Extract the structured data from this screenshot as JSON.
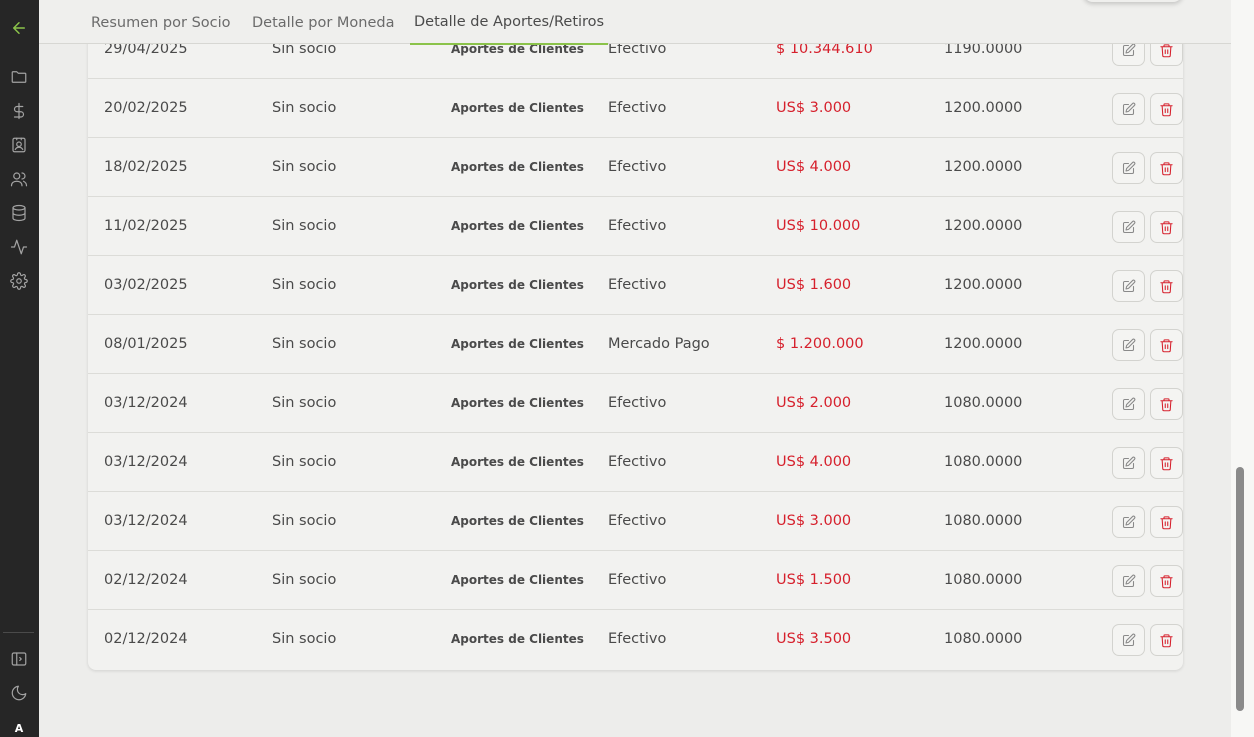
{
  "sidebar": {
    "icons": [
      "back-arrow-icon",
      "folder-icon",
      "dollar-icon",
      "contact-book-icon",
      "users-icon",
      "database-icon",
      "activity-icon",
      "gear-icon",
      "sidebar-toggle-icon",
      "moon-icon"
    ],
    "avatar_letter": "A"
  },
  "tabs": [
    {
      "label": "Resumen por Socio",
      "active": false
    },
    {
      "label": "Detalle por Moneda",
      "active": false
    },
    {
      "label": "Detalle de Aportes/Retiros",
      "active": true
    }
  ],
  "colors": {
    "accent": "#8bc34a",
    "amount": "#d6202c",
    "sidebar": "#262626"
  },
  "rows": [
    {
      "fecha": "29/04/2025",
      "socio": "Sin socio",
      "tipo": "Aportes de Clientes",
      "medio": "Efectivo",
      "monto": "$ 10.344.610",
      "cotizacion": "1190.0000"
    },
    {
      "fecha": "20/02/2025",
      "socio": "Sin socio",
      "tipo": "Aportes de Clientes",
      "medio": "Efectivo",
      "monto": "US$ 3.000",
      "cotizacion": "1200.0000"
    },
    {
      "fecha": "18/02/2025",
      "socio": "Sin socio",
      "tipo": "Aportes de Clientes",
      "medio": "Efectivo",
      "monto": "US$ 4.000",
      "cotizacion": "1200.0000"
    },
    {
      "fecha": "11/02/2025",
      "socio": "Sin socio",
      "tipo": "Aportes de Clientes",
      "medio": "Efectivo",
      "monto": "US$ 10.000",
      "cotizacion": "1200.0000"
    },
    {
      "fecha": "03/02/2025",
      "socio": "Sin socio",
      "tipo": "Aportes de Clientes",
      "medio": "Efectivo",
      "monto": "US$ 1.600",
      "cotizacion": "1200.0000"
    },
    {
      "fecha": "08/01/2025",
      "socio": "Sin socio",
      "tipo": "Aportes de Clientes",
      "medio": "Mercado Pago",
      "monto": "$ 1.200.000",
      "cotizacion": "1200.0000"
    },
    {
      "fecha": "03/12/2024",
      "socio": "Sin socio",
      "tipo": "Aportes de Clientes",
      "medio": "Efectivo",
      "monto": "US$ 2.000",
      "cotizacion": "1080.0000"
    },
    {
      "fecha": "03/12/2024",
      "socio": "Sin socio",
      "tipo": "Aportes de Clientes",
      "medio": "Efectivo",
      "monto": "US$ 4.000",
      "cotizacion": "1080.0000"
    },
    {
      "fecha": "03/12/2024",
      "socio": "Sin socio",
      "tipo": "Aportes de Clientes",
      "medio": "Efectivo",
      "monto": "US$ 3.000",
      "cotizacion": "1080.0000"
    },
    {
      "fecha": "02/12/2024",
      "socio": "Sin socio",
      "tipo": "Aportes de Clientes",
      "medio": "Efectivo",
      "monto": "US$ 1.500",
      "cotizacion": "1080.0000"
    },
    {
      "fecha": "02/12/2024",
      "socio": "Sin socio",
      "tipo": "Aportes de Clientes",
      "medio": "Efectivo",
      "monto": "US$ 3.500",
      "cotizacion": "1080.0000"
    }
  ]
}
